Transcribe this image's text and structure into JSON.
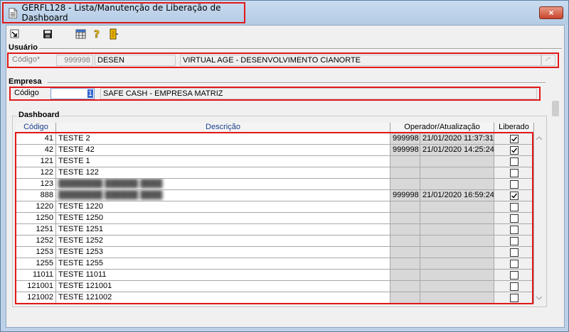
{
  "window": {
    "title": "GERFL128 - Lista/Manutenção de Liberação de Dashboard",
    "close_label": "×"
  },
  "toolbar": {
    "buttons": [
      "exit-arrow-icon",
      "save-icon",
      "grid-icon",
      "help-icon",
      "door-exit-icon"
    ]
  },
  "usuario": {
    "section_label": "Usuário",
    "code_label": "Código*",
    "code_value": "999998",
    "login": "DESEN",
    "name": "VIRTUAL AGE - DESENVOLVIMENTO CIANORTE"
  },
  "empresa": {
    "section_label": "Empresa",
    "code_label": "Código",
    "code_value": "1",
    "name": "SAFE CASH - EMPRESA MATRIZ"
  },
  "dashboard": {
    "section_label": "Dashboard",
    "columns": {
      "codigo": "Código",
      "descricao": "Descrição",
      "operador": "Operador/Atualização",
      "liberado": "Liberado"
    },
    "rows": [
      {
        "code": "41",
        "desc": "TESTE 2",
        "op": "999998",
        "date": "21/01/2020 11:37:31",
        "checked": true,
        "blur": false
      },
      {
        "code": "42",
        "desc": "TESTE 42",
        "op": "999998",
        "date": "21/01/2020 14:25:24",
        "checked": true,
        "blur": false
      },
      {
        "code": "121",
        "desc": "TESTE 1",
        "op": "",
        "date": "",
        "checked": false,
        "blur": false
      },
      {
        "code": "122",
        "desc": "TESTE 122",
        "op": "",
        "date": "",
        "checked": false,
        "blur": false
      },
      {
        "code": "123",
        "desc": "",
        "op": "",
        "date": "",
        "checked": false,
        "blur": true
      },
      {
        "code": "888",
        "desc": "",
        "op": "999998",
        "date": "21/01/2020 16:59:24",
        "checked": true,
        "blur": true
      },
      {
        "code": "1220",
        "desc": "TESTE 1220",
        "op": "",
        "date": "",
        "checked": false,
        "blur": false
      },
      {
        "code": "1250",
        "desc": "TESTE 1250",
        "op": "",
        "date": "",
        "checked": false,
        "blur": false
      },
      {
        "code": "1251",
        "desc": "TESTE 1251",
        "op": "",
        "date": "",
        "checked": false,
        "blur": false
      },
      {
        "code": "1252",
        "desc": "TESTE 1252",
        "op": "",
        "date": "",
        "checked": false,
        "blur": false
      },
      {
        "code": "1253",
        "desc": "TESTE 1253",
        "op": "",
        "date": "",
        "checked": false,
        "blur": false
      },
      {
        "code": "1255",
        "desc": "TESTE 1255",
        "op": "",
        "date": "",
        "checked": false,
        "blur": false
      },
      {
        "code": "11011",
        "desc": "TESTE 11011",
        "op": "",
        "date": "",
        "checked": false,
        "blur": false
      },
      {
        "code": "121001",
        "desc": "TESTE 121001",
        "op": "",
        "date": "",
        "checked": false,
        "blur": false
      },
      {
        "code": "121002",
        "desc": "TESTE 121002",
        "op": "",
        "date": "",
        "checked": false,
        "blur": false
      }
    ]
  }
}
